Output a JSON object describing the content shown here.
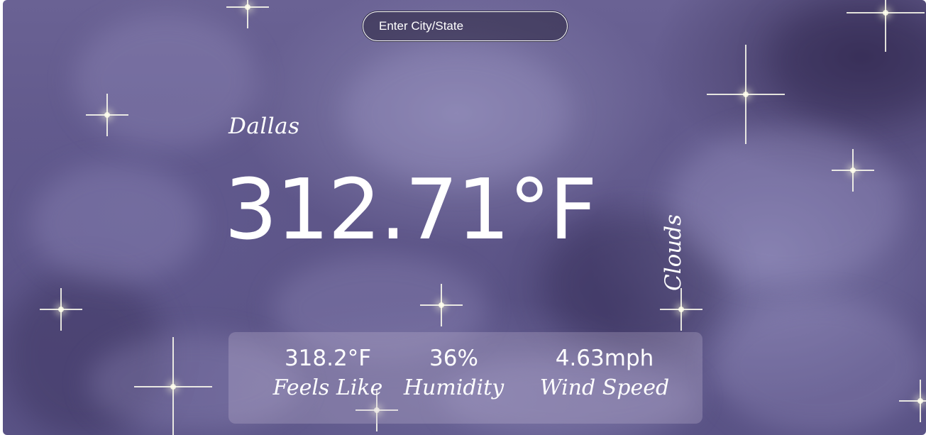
{
  "search": {
    "placeholder": "Enter City/State",
    "value": ""
  },
  "weather": {
    "city": "Dallas",
    "temperature": "312.71°F",
    "condition": "Clouds"
  },
  "stats": {
    "feels_like": {
      "value": "318.2°F",
      "label": "Feels Like"
    },
    "humidity": {
      "value": "36%",
      "label": "Humidity"
    },
    "wind_speed": {
      "value": "4.63mph",
      "label": "Wind Speed"
    }
  },
  "colors": {
    "background": "#5e5689",
    "text": "#ffffff",
    "stats_panel": "rgba(200,190,215,0.28)"
  },
  "background_image": "purple-night-clouds-with-sparkles"
}
